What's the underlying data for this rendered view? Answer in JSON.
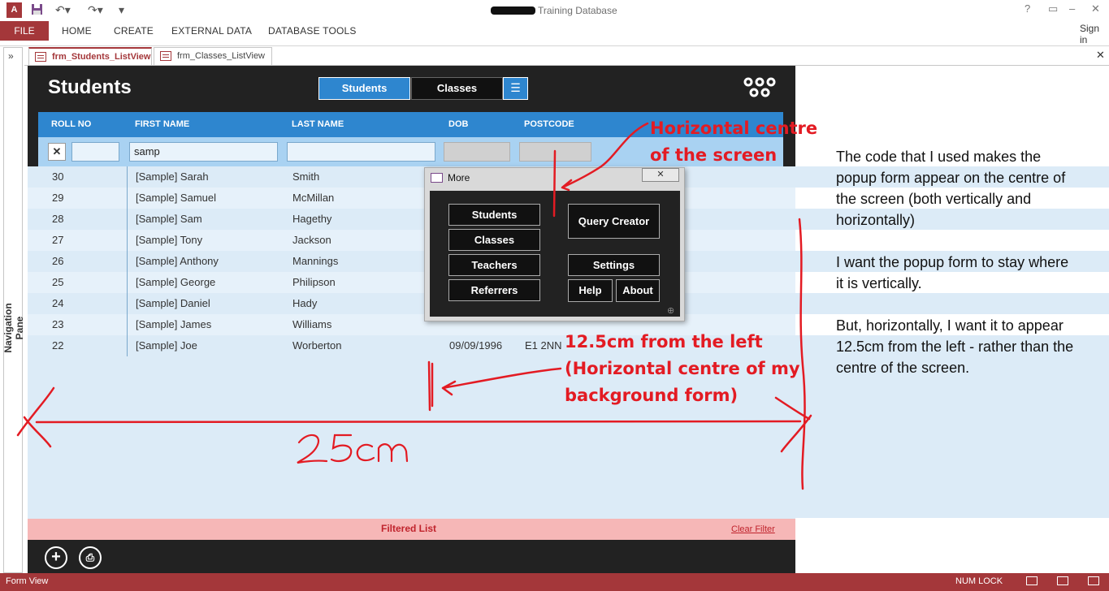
{
  "app": {
    "icon_label": "A",
    "window_title": "Training Database"
  },
  "ribbon": {
    "file": "FILE",
    "tabs": [
      "HOME",
      "CREATE",
      "EXTERNAL DATA",
      "DATABASE TOOLS"
    ],
    "sign_in": "Sign in"
  },
  "nav": {
    "label": "Navigation Pane",
    "toggle": "»"
  },
  "doc_tabs": [
    "frm_Students_ListView",
    "frm_Classes_ListView"
  ],
  "form": {
    "title": "Students",
    "nav_buttons": {
      "students": "Students",
      "classes": "Classes",
      "menu": "☰"
    },
    "columns": [
      "ROLL NO",
      "FIRST NAME",
      "LAST NAME",
      "DOB",
      "POSTCODE"
    ],
    "filter": {
      "first_name": "samp"
    },
    "rows": [
      {
        "roll": "30",
        "first": "[Sample] Sarah",
        "last": "Smith",
        "dob": "",
        "postcode": ""
      },
      {
        "roll": "29",
        "first": "[Sample] Samuel",
        "last": "McMillan",
        "dob": "",
        "postcode": ""
      },
      {
        "roll": "28",
        "first": "[Sample] Sam",
        "last": "Hagethy",
        "dob": "",
        "postcode": ""
      },
      {
        "roll": "27",
        "first": "[Sample] Tony",
        "last": "Jackson",
        "dob": "",
        "postcode": ""
      },
      {
        "roll": "26",
        "first": "[Sample] Anthony",
        "last": "Mannings",
        "dob": "",
        "postcode": ""
      },
      {
        "roll": "25",
        "first": "[Sample] George",
        "last": "Philipson",
        "dob": "",
        "postcode": ""
      },
      {
        "roll": "24",
        "first": "[Sample] Daniel",
        "last": "Hady",
        "dob": "",
        "postcode": ""
      },
      {
        "roll": "23",
        "first": "[Sample] James",
        "last": "Williams",
        "dob": "",
        "postcode": ""
      },
      {
        "roll": "22",
        "first": "[Sample] Joe",
        "last": "Worberton",
        "dob": "09/09/1996",
        "postcode": "E1 2NN"
      }
    ],
    "footer": {
      "filtered": "Filtered List",
      "clear": "Clear Filter"
    }
  },
  "popup": {
    "title": "More",
    "buttons": {
      "students": "Students",
      "classes": "Classes",
      "teachers": "Teachers",
      "referrers": "Referrers",
      "query_creator": "Query Creator",
      "settings": "Settings",
      "help": "Help",
      "about": "About"
    }
  },
  "annotations": {
    "horizontal_centre": [
      "Horizontal centre",
      "of the screen"
    ],
    "from_left": [
      "12.5cm from the left",
      "(Horizontal centre of my",
      "background form)"
    ],
    "width_label": "25cm"
  },
  "explanation": [
    "The code that I used makes the popup form appear on the centre of the screen (both vertically and horizontally)",
    "I want the popup form to stay where it is vertically.",
    "But, horizontally, I want it to appear 12.5cm from the left - rather than the centre of the screen."
  ],
  "status": {
    "view": "Form View",
    "num_lock": "NUM LOCK"
  },
  "colors": {
    "access_red": "#a4373a",
    "header_blue": "#2e86cf",
    "form_bg": "#dcebf7",
    "annotation_red": "#e31b23"
  }
}
